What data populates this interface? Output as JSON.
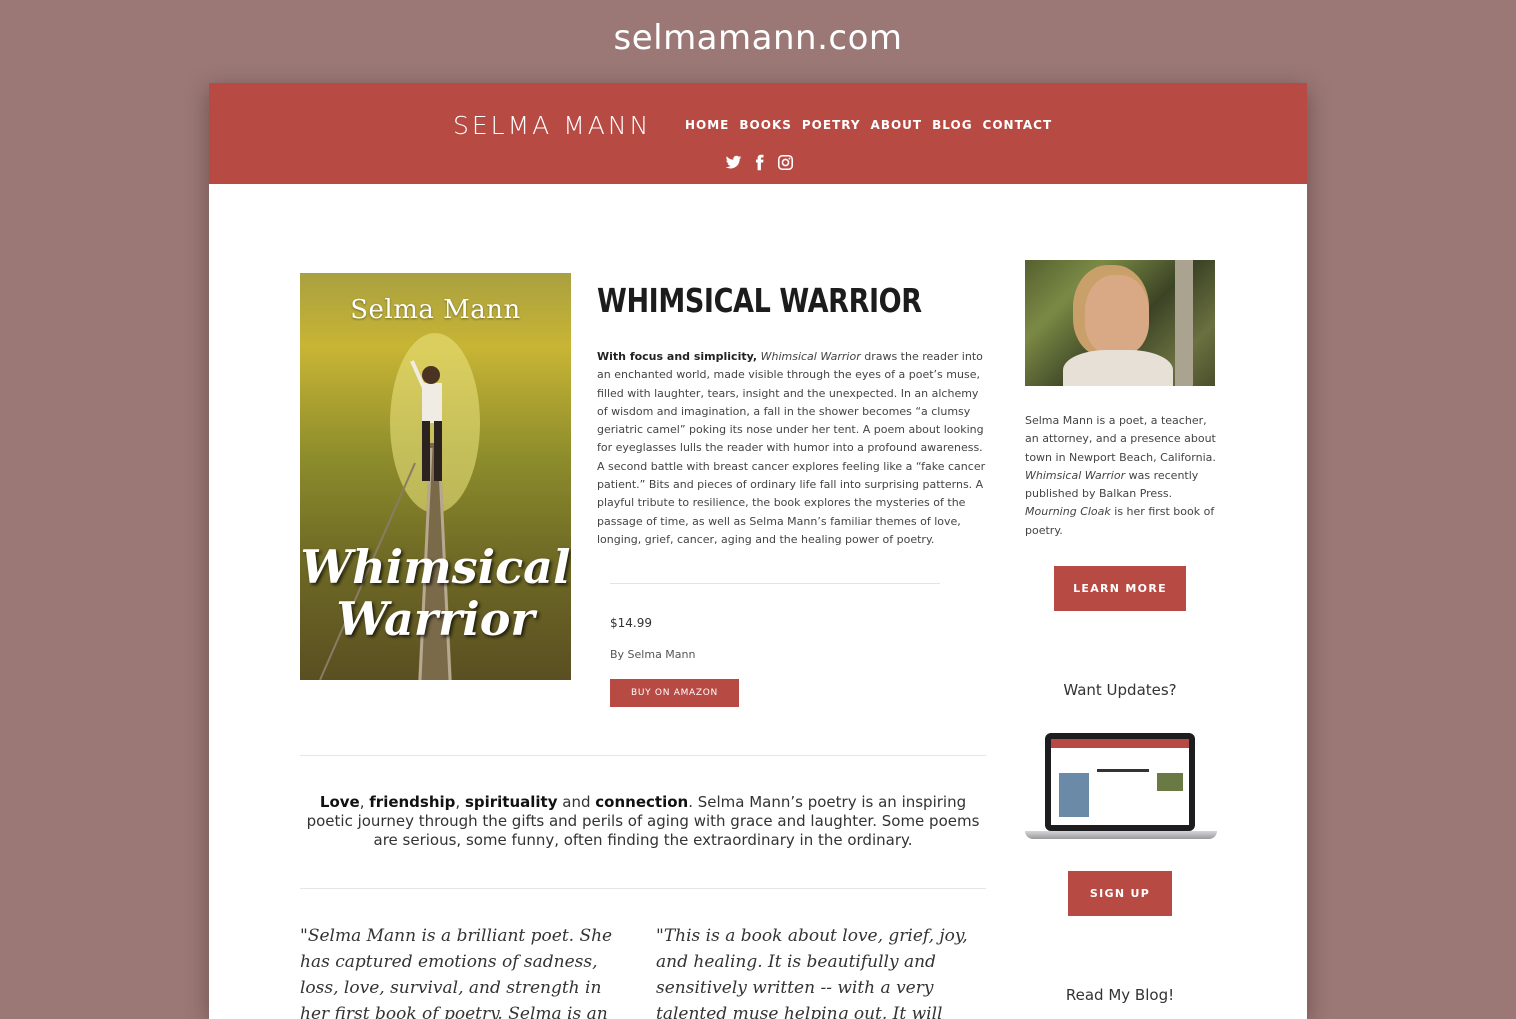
{
  "site_url": "selmamann.com",
  "header": {
    "brand": "SELMA MANN",
    "nav": [
      "HOME",
      "BOOKS",
      "POETRY",
      "ABOUT",
      "BLOG",
      "CONTACT"
    ],
    "social_icons": [
      "twitter-icon",
      "facebook-icon",
      "instagram-icon"
    ]
  },
  "book": {
    "cover_author": "Selma Mann",
    "cover_title_line1": "Whimsical",
    "cover_title_line2": "Warrior",
    "title": "WHIMSICAL WARRIOR",
    "desc_lead": "With focus and simplicity,",
    "desc_title_italic": "Whimsical Warrior",
    "desc_rest": " draws the reader into an enchanted world, made visible through the eyes of a poet’s muse, filled with laughter, tears, insight and the unexpected.  In an alchemy of wisdom and imagination, a fall in the shower becomes “a clumsy geriatric camel” poking its nose under her tent. A poem about looking for eyeglasses lulls the reader with humor into a profound awareness.  A second battle with breast cancer explores feeling like a “fake cancer patient.”  Bits and pieces of ordinary life fall into surprising patterns.  A playful tribute to resilience, the book explores the mysteries of the passage of time, as well as Selma Mann’s familiar themes of love, longing, grief, cancer, aging and the healing power of poetry.",
    "price": "$14.99",
    "byline": "By Selma Mann",
    "buy_label": "BUY ON AMAZON"
  },
  "tagline": {
    "w1": "Love",
    "sep1": ", ",
    "w2": "friendship",
    "sep2": ", ",
    "w3": "spirituality",
    "sep3": " and ",
    "w4": "connection",
    "rest": ". Selma Mann’s poetry is an inspiring poetic journey through the gifts and perils of aging with grace and laughter. Some poems  are serious, some funny, often finding the extraordinary in the ordinary."
  },
  "quotes": [
    "\"Selma Mann is a brilliant poet. She has captured emotions of sadness, loss, love, survival, and strength in her first book of poetry. Selma is an inspiration to all women",
    "\"This is a book about love, grief, joy, and healing. It is beautifully and sensitively written -- with a very talented muse helping out. It will make a wonderful gift for certain"
  ],
  "sidebar": {
    "bio_part1": "Selma Mann is a poet, a teacher, an attorney, and a presence about town in Newport Beach, California. ",
    "bio_italic1": "Whimsical Warrior",
    "bio_part2": " was recently published by Balkan Press. ",
    "bio_italic2": "Mourning Cloak",
    "bio_part3": " is her first book of poetry.",
    "learn_more_label": "LEARN MORE",
    "updates_title": "Want Updates?",
    "signup_label": "SIGN UP",
    "blog_title": "Read My Blog!"
  },
  "colors": {
    "brand_red": "#b84a44",
    "page_background": "#9b7876"
  }
}
